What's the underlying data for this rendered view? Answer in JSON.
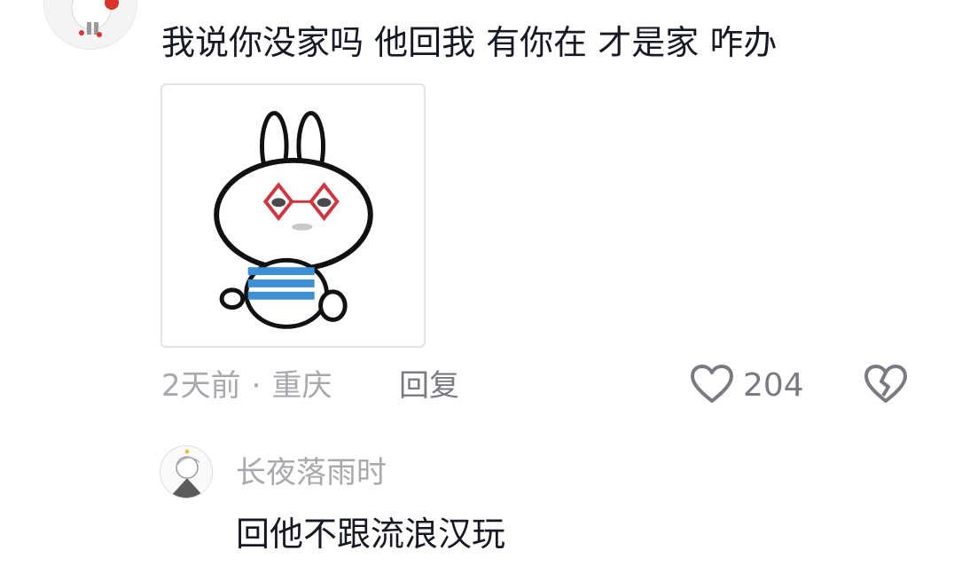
{
  "comment": {
    "text": "我说你没家吗 他回我 有你在 才是家 咋办",
    "time": "2天前",
    "location": "重庆",
    "reply_label": "回复",
    "like_count": "204"
  },
  "reply": {
    "username": "长夜落雨时",
    "text": "回他不跟流浪汉玩"
  },
  "icons": {
    "like": "heart-outline-icon",
    "dislike": "broken-heart-icon"
  },
  "colors": {
    "text_primary": "#161823",
    "text_secondary": "#a8a8ad",
    "icon": "#7a7a80"
  }
}
